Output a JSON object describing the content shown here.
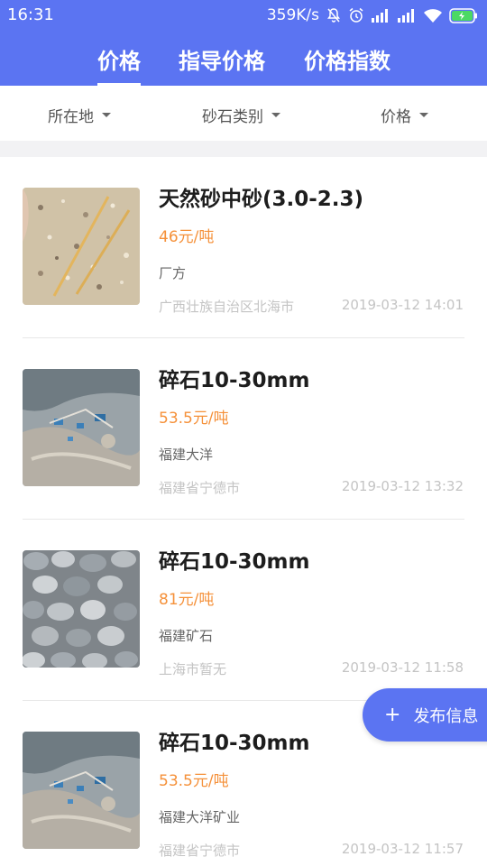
{
  "status_bar": {
    "time": "16:31",
    "net_speed": "359K/s"
  },
  "tabs": [
    {
      "label": "价格",
      "active": true
    },
    {
      "label": "指导价格",
      "active": false
    },
    {
      "label": "价格指数",
      "active": false
    }
  ],
  "filters": [
    {
      "label": "所在地"
    },
    {
      "label": "砂石类别"
    },
    {
      "label": "价格"
    }
  ],
  "items": [
    {
      "title": "天然砂中砂(3.0-2.3)",
      "price": "46元/吨",
      "supplier": "厂方",
      "region": "广西壮族自治区北海市",
      "time": "2019-03-12 14:01",
      "image": "sand-photo"
    },
    {
      "title": "碎石10-30mm",
      "price": "53.5元/吨",
      "supplier": "福建大洋",
      "region": "福建省宁德市",
      "time": "2019-03-12 13:32",
      "image": "quarry-aerial-photo"
    },
    {
      "title": "碎石10-30mm",
      "price": "81元/吨",
      "supplier": "福建矿石",
      "region": "上海市暂无",
      "time": "2019-03-12 11:58",
      "image": "gravel-photo"
    },
    {
      "title": "碎石10-30mm",
      "price": "53.5元/吨",
      "supplier": "福建大洋矿业",
      "region": "福建省宁德市",
      "time": "2019-03-12 11:57",
      "image": "quarry-aerial-photo"
    }
  ],
  "fab": {
    "label": "发布信息",
    "icon": "plus-icon"
  },
  "colors": {
    "primary": "#5b74f2",
    "price": "#f5913a"
  }
}
